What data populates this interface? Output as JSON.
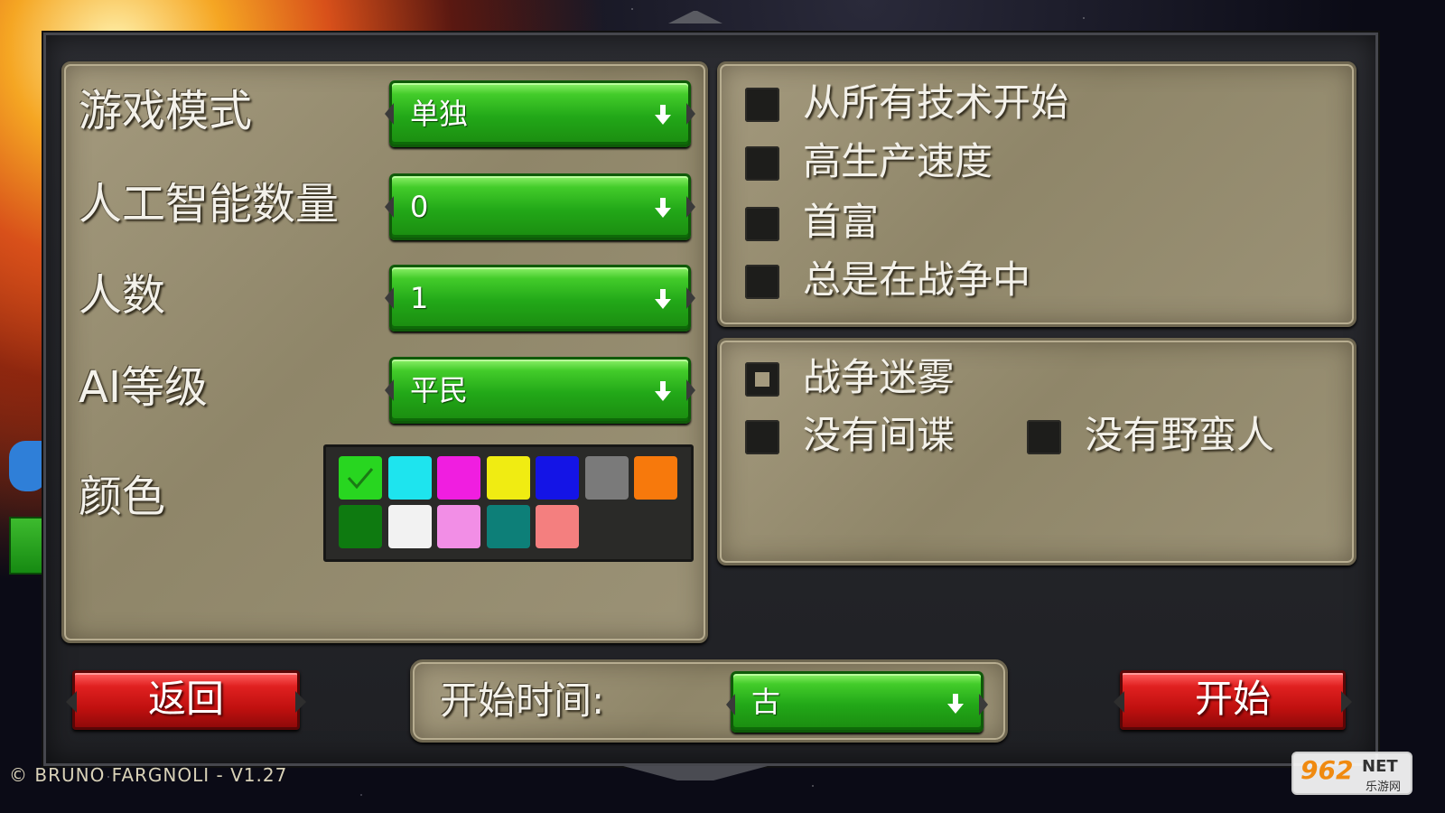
{
  "left": {
    "rows": [
      {
        "label": "游戏模式",
        "value": "单独"
      },
      {
        "label": "人工智能数量",
        "value": "0"
      },
      {
        "label": "人数",
        "value": "1"
      },
      {
        "label": "AI等级",
        "value": "平民"
      }
    ],
    "color_label": "颜色",
    "colors": [
      "#28d620",
      "#1ee4ee",
      "#f01ee0",
      "#f0ec12",
      "#1414e6",
      "#7a7a7a",
      "#f7790c",
      "#0e7a10",
      "#f2f2f2",
      "#f28ee6",
      "#0d7f78",
      "#f47f7f"
    ],
    "selected_color_index": 0
  },
  "options_top": [
    {
      "label": "从所有技术开始",
      "checked": false
    },
    {
      "label": "高生产速度",
      "checked": false
    },
    {
      "label": "首富",
      "checked": false
    },
    {
      "label": "总是在战争中",
      "checked": false
    }
  ],
  "options_mid": [
    {
      "label": "战争迷雾",
      "checked": true
    },
    {
      "label": "没有间谍",
      "checked": false
    },
    {
      "label": "没有野蛮人",
      "checked": false
    }
  ],
  "bottom": {
    "back_label": "返回",
    "start_time_label": "开始时间:",
    "start_time_value": "古",
    "start_label": "开始"
  },
  "copyright": "© BRUNO FARGNOLI - V1.27",
  "watermark": {
    "num": "962",
    "net": "NET",
    "sub": "乐游网"
  }
}
